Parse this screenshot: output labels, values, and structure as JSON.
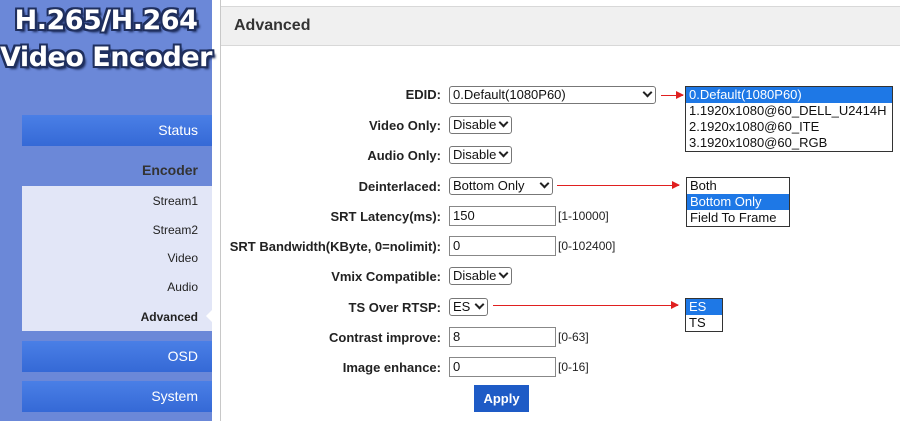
{
  "logo": {
    "line1": "H.265/H.264",
    "line2": "Video Encoder"
  },
  "sidebar": {
    "status": "Status",
    "encoder": "Encoder",
    "encoder_items": [
      "Stream1",
      "Stream2",
      "Video",
      "Audio",
      "Advanced"
    ],
    "osd": "OSD",
    "system": "System"
  },
  "main": {
    "title": "Advanced",
    "fields": {
      "edid": {
        "label": "EDID:",
        "value": "0.Default(1080P60)"
      },
      "video_only": {
        "label": "Video Only:",
        "value": "Disable"
      },
      "audio_only": {
        "label": "Audio Only:",
        "value": "Disable"
      },
      "deinterlaced": {
        "label": "Deinterlaced:",
        "value": "Bottom Only"
      },
      "srt_latency": {
        "label": "SRT Latency(ms):",
        "value": "150",
        "range": "[1-10000]"
      },
      "srt_bandwidth": {
        "label": "SRT Bandwidth(KByte, 0=nolimit):",
        "value": "0",
        "range": "[0-102400]"
      },
      "vmix": {
        "label": "Vmix Compatible:",
        "value": "Disable"
      },
      "ts_rtsp": {
        "label": "TS Over RTSP:",
        "value": "ES"
      },
      "contrast": {
        "label": "Contrast improve:",
        "value": "8",
        "range": "[0-63]"
      },
      "image_enh": {
        "label": "Image enhance:",
        "value": "0",
        "range": "[0-16]"
      }
    },
    "apply_label": "Apply"
  },
  "dropdowns": {
    "edid_options": [
      "0.Default(1080P60)",
      "1.1920x1080@60_DELL_U2414H",
      "2.1920x1080@60_ITE",
      "3.1920x1080@60_RGB"
    ],
    "deinterlaced_options": [
      "Both",
      "Bottom Only",
      "Field To Frame"
    ],
    "ts_options": [
      "ES",
      "TS"
    ]
  },
  "colors": {
    "sidebar_bg": "#6b88d8",
    "nav_bar": "#3a6fdc",
    "submenu_bg": "#e2e6f7",
    "apply_bg": "#1e5bc6",
    "highlight": "#1e78e6",
    "arrow": "#e02020"
  }
}
